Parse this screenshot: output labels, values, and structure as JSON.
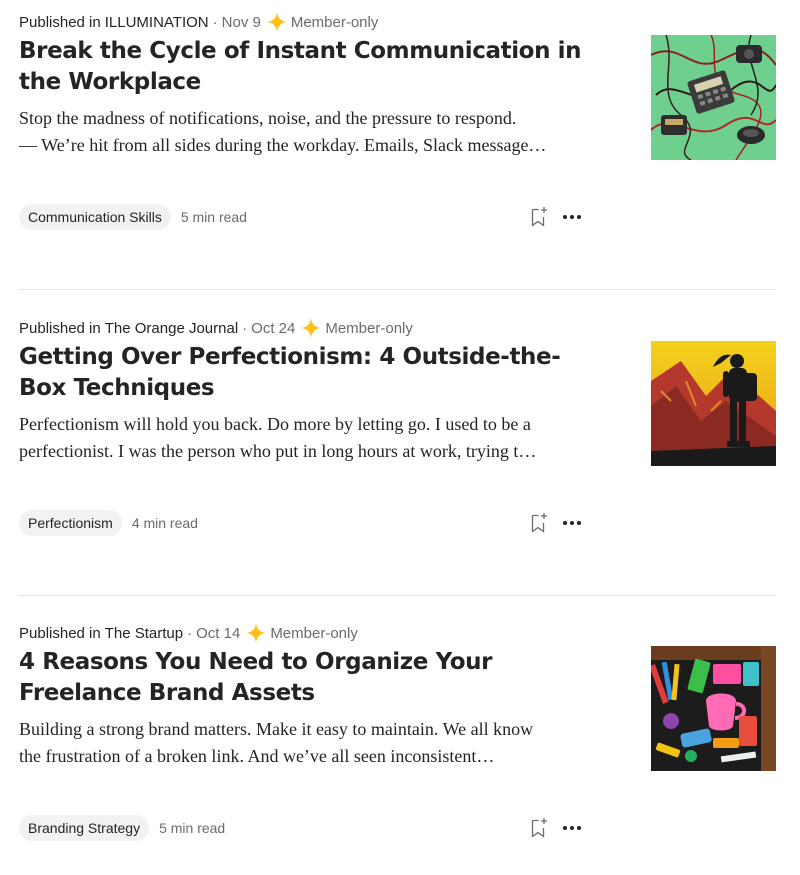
{
  "colors": {
    "member_star": "#ffc017",
    "muted": "#6b6b6b",
    "tag_bg": "#f2f2f2"
  },
  "articles": [
    {
      "published_prefix": "Published in",
      "publication": "ILLUMINATION",
      "date": "Nov 9",
      "member_label": "Member-only",
      "title": "Break the Cycle of Instant Communication in the Workplace",
      "subtitle_line1": "Stop the madness of notifications, noise, and the pressure to respond.",
      "subtitle_line2": "— We’re hit from all sides during the workday. Emails, Slack message…",
      "tag": "Communication Skills",
      "read_time": "5 min read",
      "thumbnail_icon": "tangled-phones-illustration"
    },
    {
      "published_prefix": "Published in",
      "publication": "The Orange Journal",
      "date": "Oct 24",
      "member_label": "Member-only",
      "title": "Getting Over Perfectionism: 4 Outside-the-Box Techniques",
      "subtitle_line1": "Perfectionism will hold you back. Do more by letting go. I used to be a",
      "subtitle_line2": "perfectionist. I was the person who put in long hours at work, trying t…",
      "tag": "Perfectionism",
      "read_time": "4 min read",
      "thumbnail_icon": "hiker-silhouette-illustration"
    },
    {
      "published_prefix": "Published in",
      "publication": "The Startup",
      "date": "Oct 14",
      "member_label": "Member-only",
      "title": "4 Reasons You Need to Organize Your Freelance Brand Assets",
      "subtitle_line1": "Building a strong brand matters. Make it easy to maintain. We all know",
      "subtitle_line2": "the frustration of a broken link. And we’ve all seen inconsistent…",
      "tag": "Branding Strategy",
      "read_time": "5 min read",
      "thumbnail_icon": "messy-drawer-illustration"
    }
  ]
}
